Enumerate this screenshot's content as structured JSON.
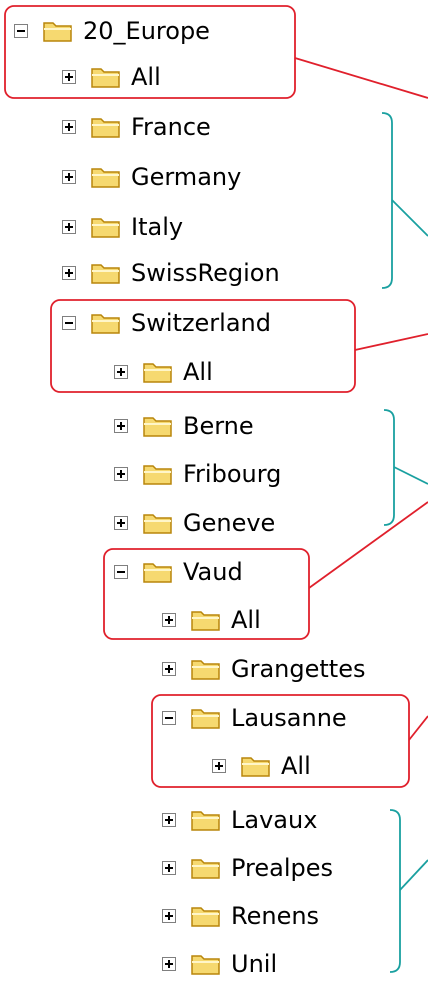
{
  "tree": {
    "items": [
      {
        "label": "20_Europe",
        "expanded": true
      },
      {
        "label": "All",
        "expanded": false
      },
      {
        "label": "France",
        "expanded": false
      },
      {
        "label": "Germany",
        "expanded": false
      },
      {
        "label": "Italy",
        "expanded": false
      },
      {
        "label": "SwissRegion",
        "expanded": false
      },
      {
        "label": "Switzerland",
        "expanded": true
      },
      {
        "label": "All",
        "expanded": false
      },
      {
        "label": "Berne",
        "expanded": false
      },
      {
        "label": "Fribourg",
        "expanded": false
      },
      {
        "label": "Geneve",
        "expanded": false
      },
      {
        "label": "Vaud",
        "expanded": true
      },
      {
        "label": "All",
        "expanded": false
      },
      {
        "label": "Grangettes",
        "expanded": false
      },
      {
        "label": "Lausanne",
        "expanded": true
      },
      {
        "label": "All",
        "expanded": false
      },
      {
        "label": "Lavaux",
        "expanded": false
      },
      {
        "label": "Prealpes",
        "expanded": false
      },
      {
        "label": "Renens",
        "expanded": false
      },
      {
        "label": "Unil",
        "expanded": false
      }
    ]
  },
  "colors": {
    "highlight_box": "#e0202c",
    "bracket": "#1aa0a0",
    "folder_fill": "#f6d970",
    "folder_outline": "#b8860b"
  }
}
